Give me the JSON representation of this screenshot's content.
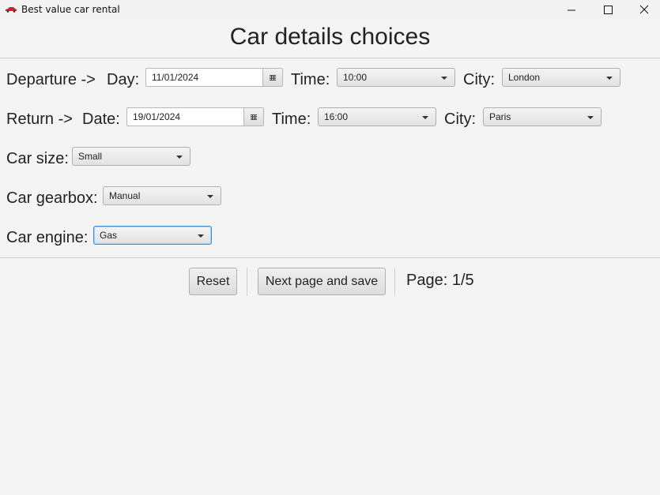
{
  "window": {
    "title": "Best value car rental",
    "controls": [
      "minimize",
      "maximize",
      "close"
    ]
  },
  "heading": "Car details choices",
  "departure": {
    "section_label": "Departure ->",
    "day_label": "Day:",
    "date_value": "11/01/2024",
    "time_label": "Time:",
    "time_value": "10:00",
    "city_label": "City:",
    "city_value": "London"
  },
  "return": {
    "section_label": "Return ->",
    "date_label": "Date:",
    "date_value": "19/01/2024",
    "time_label": "Time:",
    "time_value": "16:00",
    "city_label": "City:",
    "city_value": "Paris"
  },
  "car_size": {
    "label": "Car size:",
    "value": "Small"
  },
  "car_gearbox": {
    "label": "Car gearbox:",
    "value": "Manual"
  },
  "car_engine": {
    "label": "Car engine:",
    "value": "Gas"
  },
  "footer": {
    "reset_label": "Reset",
    "next_label": "Next page and save",
    "page_indicator": "Page: 1/5"
  },
  "colors": {
    "focus_accent": "#3c8fd6",
    "app_icon": "#c0282d"
  }
}
